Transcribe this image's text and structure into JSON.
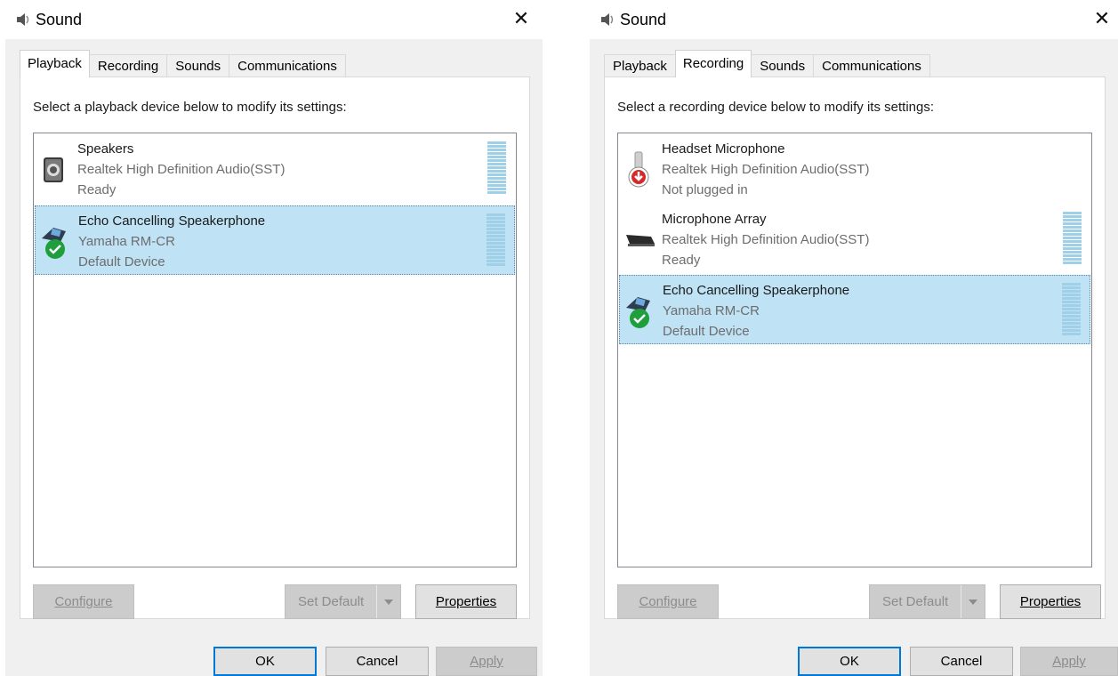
{
  "dialogs": [
    {
      "title": "Sound",
      "tabs": [
        "Playback",
        "Recording",
        "Sounds",
        "Communications"
      ],
      "active_tab": "Playback",
      "instruction": "Select a playback device below to modify its settings:",
      "devices": [
        {
          "name": "Speakers",
          "driver": "Realtek High Definition Audio(SST)",
          "status": "Ready",
          "icon": "speaker-icon",
          "selected": false
        },
        {
          "name": "Echo Cancelling Speakerphone",
          "driver": "Yamaha RM-CR",
          "status": "Default Device",
          "icon": "speakerphone-icon",
          "selected": true
        }
      ],
      "buttons": {
        "configure": "Configure",
        "set_default": "Set Default",
        "properties": "Properties"
      },
      "footer": {
        "ok": "OK",
        "cancel": "Cancel",
        "apply": "Apply"
      }
    },
    {
      "title": "Sound",
      "tabs": [
        "Playback",
        "Recording",
        "Sounds",
        "Communications"
      ],
      "active_tab": "Recording",
      "instruction": "Select a recording device below to modify its settings:",
      "devices": [
        {
          "name": "Headset Microphone",
          "driver": "Realtek High Definition Audio(SST)",
          "status": "Not plugged in",
          "icon": "headset-microphone-icon",
          "selected": false
        },
        {
          "name": "Microphone Array",
          "driver": "Realtek High Definition Audio(SST)",
          "status": "Ready",
          "icon": "microphone-array-icon",
          "selected": false
        },
        {
          "name": "Echo Cancelling Speakerphone",
          "driver": "Yamaha RM-CR",
          "status": "Default Device",
          "icon": "speakerphone-icon",
          "selected": true
        }
      ],
      "buttons": {
        "configure": "Configure",
        "set_default": "Set Default",
        "properties": "Properties"
      },
      "footer": {
        "ok": "OK",
        "cancel": "Cancel",
        "apply": "Apply"
      }
    }
  ],
  "colors": {
    "selection": "#bfe2f5",
    "focus_border": "#0078d7",
    "meter": "#9fd0e8",
    "default_check": "#1e9f3c",
    "unplugged": "#d42a2a"
  }
}
